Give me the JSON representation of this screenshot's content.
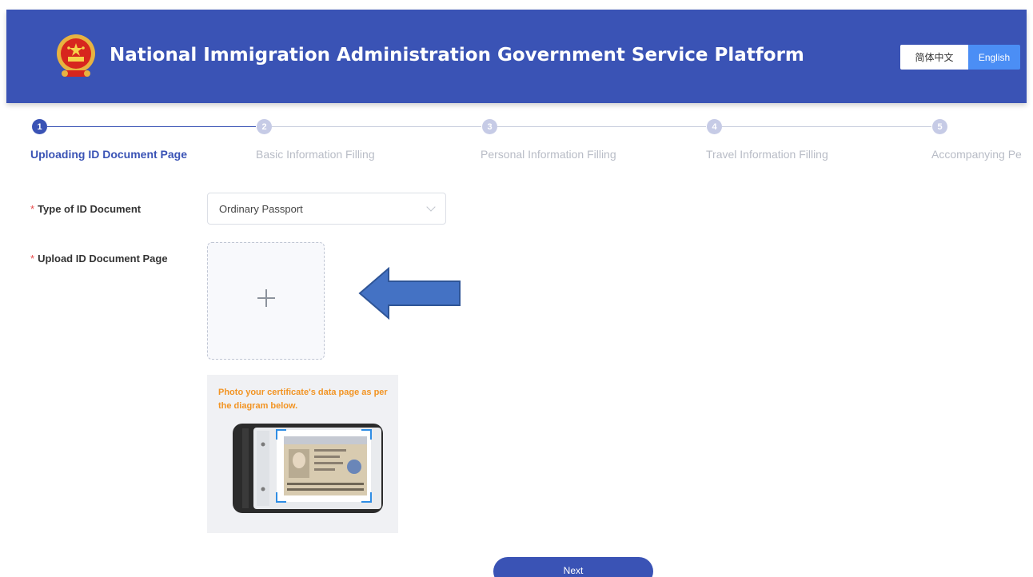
{
  "header": {
    "title": "National Immigration Administration Government Service Platform",
    "emblem_icon": "national-emblem-icon",
    "lang_chinese": "简体中文",
    "lang_english": "English",
    "colors": {
      "brand": "#3a53b5",
      "lang_active": "#4b8ef5"
    }
  },
  "steps": [
    {
      "number": "1",
      "label": "Uploading ID Document Page",
      "active": true
    },
    {
      "number": "2",
      "label": "Basic Information Filling",
      "active": false
    },
    {
      "number": "3",
      "label": "Personal Information Filling",
      "active": false
    },
    {
      "number": "4",
      "label": "Travel Information Filling",
      "active": false
    },
    {
      "number": "5",
      "label": "Accompanying Pe",
      "active": false
    }
  ],
  "form": {
    "required_mark": "*",
    "id_type": {
      "label": "Type of ID Document",
      "value": "Ordinary Passport"
    },
    "upload": {
      "label": "Upload ID Document Page",
      "icon": "plus-icon"
    },
    "hint": "Photo your certificate's data page as per the diagram below.",
    "hint_color": "#f29423"
  },
  "annotation": {
    "icon": "left-arrow-icon",
    "color": "#4472c4"
  },
  "actions": {
    "next_label": "Next"
  }
}
